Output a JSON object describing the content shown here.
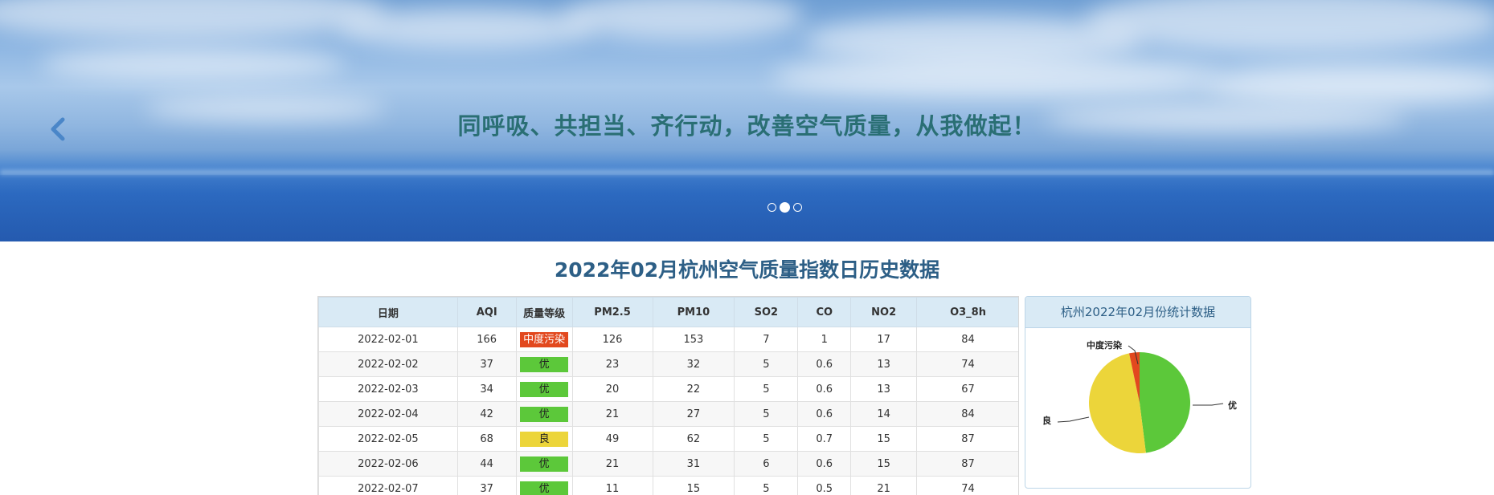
{
  "banner": {
    "caption": "同呼吸、共担当、齐行动，改善空气质量，从我做起！",
    "prev_icon": "chevron-left-icon",
    "slides": 3,
    "active_slide": 1
  },
  "page_title": "2022年02月杭州空气质量指数日历史数据",
  "table": {
    "headers": [
      "日期",
      "AQI",
      "质量等级",
      "PM2.5",
      "PM10",
      "SO2",
      "CO",
      "NO2",
      "O3_8h"
    ],
    "rows": [
      {
        "date": "2022-02-01",
        "aqi": "166",
        "level": "中度污染",
        "level_class": "moderate",
        "pm25": "126",
        "pm10": "153",
        "so2": "7",
        "co": "1",
        "no2": "17",
        "o3": "84"
      },
      {
        "date": "2022-02-02",
        "aqi": "37",
        "level": "优",
        "level_class": "good",
        "pm25": "23",
        "pm10": "32",
        "so2": "5",
        "co": "0.6",
        "no2": "13",
        "o3": "74"
      },
      {
        "date": "2022-02-03",
        "aqi": "34",
        "level": "优",
        "level_class": "good",
        "pm25": "20",
        "pm10": "22",
        "so2": "5",
        "co": "0.6",
        "no2": "13",
        "o3": "67"
      },
      {
        "date": "2022-02-04",
        "aqi": "42",
        "level": "优",
        "level_class": "good",
        "pm25": "21",
        "pm10": "27",
        "so2": "5",
        "co": "0.6",
        "no2": "14",
        "o3": "84"
      },
      {
        "date": "2022-02-05",
        "aqi": "68",
        "level": "良",
        "level_class": "fair",
        "pm25": "49",
        "pm10": "62",
        "so2": "5",
        "co": "0.7",
        "no2": "15",
        "o3": "87"
      },
      {
        "date": "2022-02-06",
        "aqi": "44",
        "level": "优",
        "level_class": "good",
        "pm25": "21",
        "pm10": "31",
        "so2": "6",
        "co": "0.6",
        "no2": "15",
        "o3": "87"
      },
      {
        "date": "2022-02-07",
        "aqi": "37",
        "level": "优",
        "level_class": "good",
        "pm25": "11",
        "pm10": "15",
        "so2": "5",
        "co": "0.5",
        "no2": "21",
        "o3": "74"
      }
    ]
  },
  "stats": {
    "title": "杭州2022年02月份统计数据",
    "slices": [
      {
        "label": "优",
        "share": 0.48,
        "color": "#5cc83a"
      },
      {
        "label": "良",
        "share": 0.487,
        "color": "#ecd53a"
      },
      {
        "label": "中度污染",
        "share": 0.033,
        "color": "#e2481e"
      }
    ]
  },
  "colors": {
    "title": "#2d5f86",
    "caption": "#2a6f74",
    "header_bg": "#d9eaf5"
  }
}
